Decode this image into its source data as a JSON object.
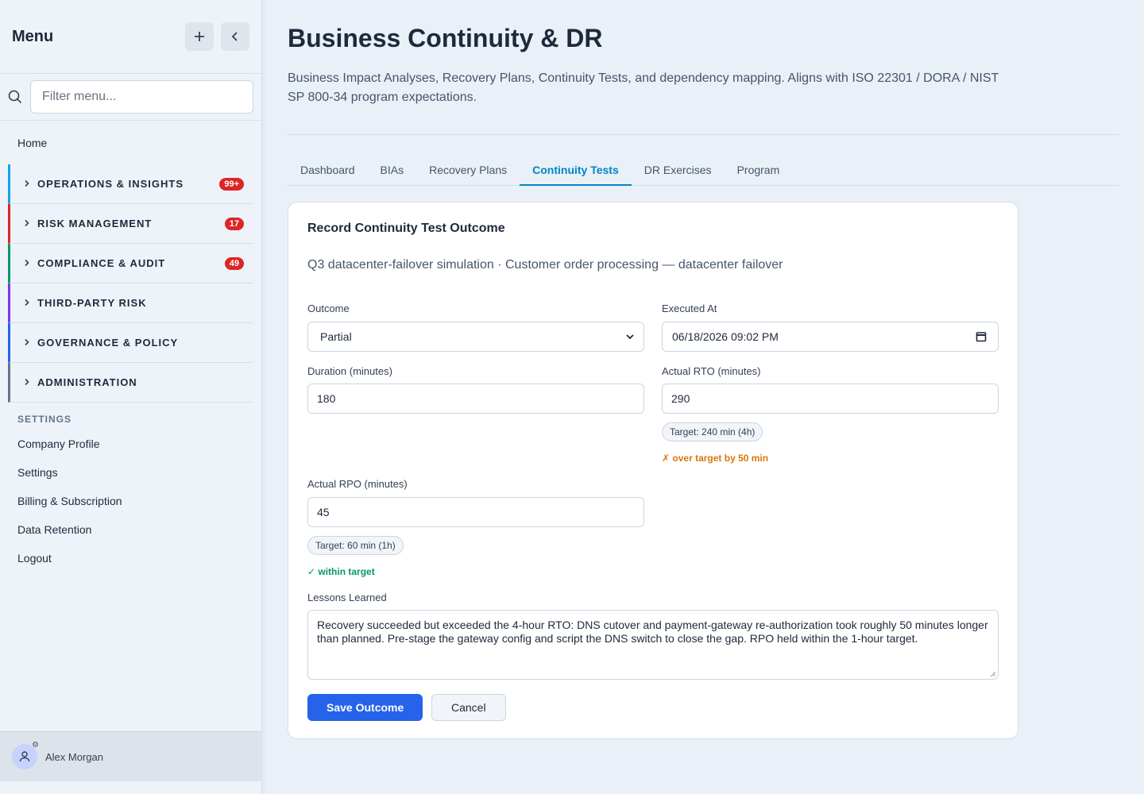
{
  "sidebar": {
    "title": "Menu",
    "filter_placeholder": "Filter menu...",
    "home": "Home",
    "groups": [
      {
        "label": "OPERATIONS & INSIGHTS",
        "badge": "99+",
        "color": "#0ea5e9"
      },
      {
        "label": "RISK MANAGEMENT",
        "badge": "17",
        "color": "#dc2626"
      },
      {
        "label": "COMPLIANCE & AUDIT",
        "badge": "49",
        "color": "#059669"
      },
      {
        "label": "THIRD-PARTY RISK",
        "badge": "",
        "color": "#7c3aed"
      },
      {
        "label": "GOVERNANCE & POLICY",
        "badge": "",
        "color": "#2563eb"
      },
      {
        "label": "ADMINISTRATION",
        "badge": "",
        "color": "#64748b"
      }
    ],
    "settings_section": "SETTINGS",
    "links": [
      "Company Profile",
      "Settings",
      "Billing & Subscription",
      "Data Retention",
      "Logout"
    ],
    "user": "Alex Morgan"
  },
  "header": {
    "title": "Business Continuity & DR",
    "description": "Business Impact Analyses, Recovery Plans, Continuity Tests, and dependency mapping. Aligns with ISO 22301 / DORA / NIST SP 800-34 program expectations."
  },
  "tabs": [
    "Dashboard",
    "BIAs",
    "Recovery Plans",
    "Continuity Tests",
    "DR Exercises",
    "Program"
  ],
  "active_tab": "Continuity Tests",
  "form": {
    "title": "Record Continuity Test Outcome",
    "subtitle": "Q3 datacenter-failover simulation · Customer order processing — datacenter failover",
    "outcome_label": "Outcome",
    "outcome_value": "Partial",
    "executed_label": "Executed At",
    "executed_value": "06/18/2026 09:02 PM",
    "duration_label": "Duration (minutes)",
    "duration_value": "180",
    "rto_label": "Actual RTO (minutes)",
    "rto_value": "290",
    "rto_target": "Target: 240 min (4h)",
    "rto_status": "✗ over target by 50 min",
    "rpo_label": "Actual RPO (minutes)",
    "rpo_value": "45",
    "rpo_target": "Target: 60 min (1h)",
    "rpo_status": "✓ within target",
    "lessons_label": "Lessons Learned",
    "lessons_value": "Recovery succeeded but exceeded the 4-hour RTO: DNS cutover and payment-gateway re-authorization took roughly 50 minutes longer than planned. Pre-stage the gateway config and script the DNS switch to close the gap. RPO held within the 1-hour target.",
    "save_label": "Save Outcome",
    "cancel_label": "Cancel"
  },
  "colors": {
    "accent": "#0284c7",
    "primary_button": "#2563eb",
    "badge": "#dc2626",
    "warning": "#d97706",
    "success": "#059669"
  }
}
